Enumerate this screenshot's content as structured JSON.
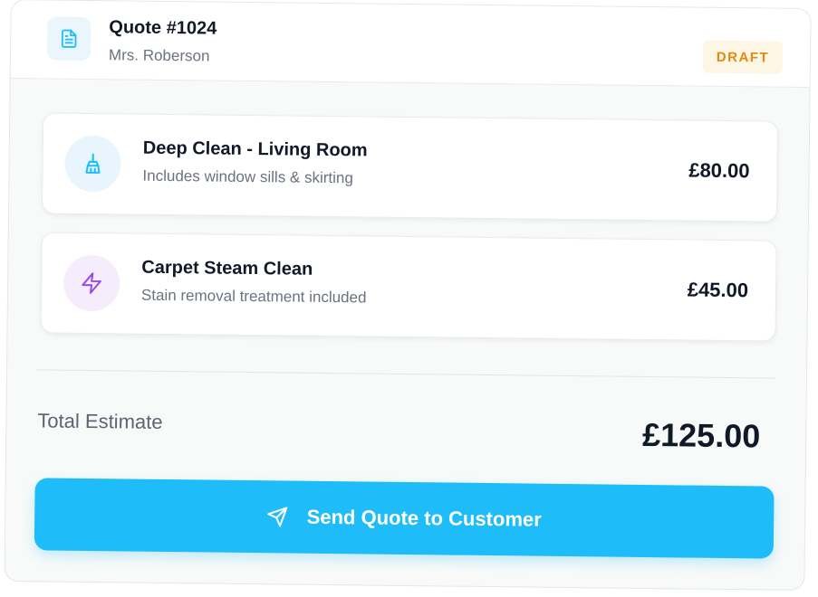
{
  "header": {
    "title": "Quote #1024",
    "customer": "Mrs. Roberson",
    "status": "DRAFT",
    "icon": "document-icon"
  },
  "items": [
    {
      "name": "Deep Clean - Living Room",
      "description": "Includes window sills & skirting",
      "price": "£80.00",
      "icon": "broom-icon",
      "icon_color": "#1ebcf8",
      "icon_bg": "#e9f5fc"
    },
    {
      "name": "Carpet Steam Clean",
      "description": "Stain removal treatment included",
      "price": "£45.00",
      "icon": "lightning-icon",
      "icon_color": "#9b4de0",
      "icon_bg": "#f5edfc"
    }
  ],
  "summary": {
    "total_label": "Total Estimate",
    "total_value": "£125.00"
  },
  "action": {
    "send_label": "Send Quote to Customer",
    "icon": "send-icon"
  },
  "colors": {
    "accent": "#1ebcf8",
    "badge_text": "#e08a12",
    "badge_bg": "#fdf6e4"
  }
}
